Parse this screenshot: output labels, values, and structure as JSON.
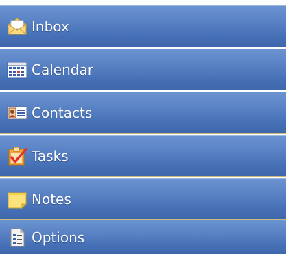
{
  "navigation": {
    "items": [
      {
        "label": "Inbox",
        "icon": "envelope-icon"
      },
      {
        "label": "Calendar",
        "icon": "calendar-icon"
      },
      {
        "label": "Contacts",
        "icon": "contact-card-icon"
      },
      {
        "label": "Tasks",
        "icon": "task-clipboard-icon"
      },
      {
        "label": "Notes",
        "icon": "note-icon"
      },
      {
        "label": "Options",
        "icon": "options-document-icon"
      }
    ]
  },
  "colors": {
    "item_background": "#4a74b9",
    "item_separator": "#c9b97a",
    "label_text": "#ffffff"
  }
}
